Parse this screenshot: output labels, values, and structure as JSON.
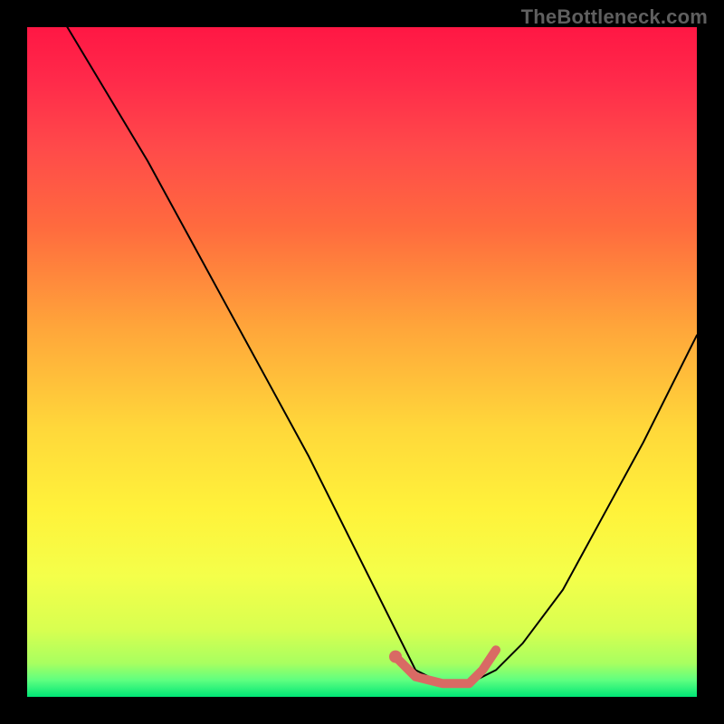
{
  "watermark": "TheBottleneck.com",
  "gradient": {
    "stops": [
      {
        "offset": 0,
        "color": "#ff1744"
      },
      {
        "offset": 0.08,
        "color": "#ff2a4a"
      },
      {
        "offset": 0.18,
        "color": "#ff4a4a"
      },
      {
        "offset": 0.3,
        "color": "#ff6b3e"
      },
      {
        "offset": 0.45,
        "color": "#ffa63a"
      },
      {
        "offset": 0.6,
        "color": "#ffd83a"
      },
      {
        "offset": 0.72,
        "color": "#fff23a"
      },
      {
        "offset": 0.82,
        "color": "#f4ff4a"
      },
      {
        "offset": 0.9,
        "color": "#d8ff50"
      },
      {
        "offset": 0.95,
        "color": "#a8ff60"
      },
      {
        "offset": 0.975,
        "color": "#5fff80"
      },
      {
        "offset": 1.0,
        "color": "#00e676"
      }
    ]
  },
  "curve_color": "#000000",
  "highlight_color": "#d96a64",
  "chart_data": {
    "type": "line",
    "title": "",
    "xlabel": "",
    "ylabel": "",
    "xlim": [
      0,
      100
    ],
    "ylim": [
      0,
      100
    ],
    "series": [
      {
        "name": "bottleneck-curve",
        "x": [
          0,
          6,
          12,
          18,
          24,
          30,
          36,
          42,
          48,
          52,
          56,
          58,
          62,
          66,
          70,
          74,
          80,
          86,
          92,
          100
        ],
        "y": [
          108,
          100,
          90,
          80,
          69,
          58,
          47,
          36,
          24,
          16,
          8,
          4,
          2,
          2,
          4,
          8,
          16,
          27,
          38,
          54
        ]
      }
    ],
    "highlight_segment": {
      "x": [
        55,
        58,
        62,
        66,
        68,
        70
      ],
      "y": [
        6,
        3,
        2,
        2,
        4,
        7
      ]
    },
    "highlight_dot": {
      "x": 55,
      "y": 6
    }
  }
}
